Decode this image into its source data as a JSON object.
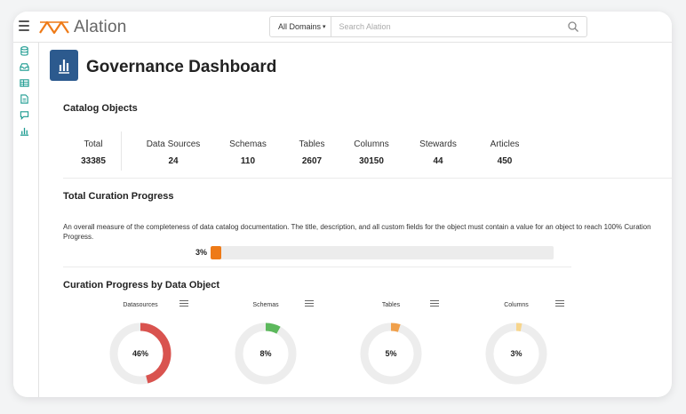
{
  "app": {
    "logo_text": "Alation"
  },
  "search": {
    "domain_label": "All Domains",
    "placeholder": "Search Alation"
  },
  "page": {
    "title": "Governance Dashboard"
  },
  "catalog": {
    "title": "Catalog Objects",
    "stats": [
      {
        "label": "Total",
        "value": "33385"
      },
      {
        "label": "Data Sources",
        "value": "24"
      },
      {
        "label": "Schemas",
        "value": "110"
      },
      {
        "label": "Tables",
        "value": "2607"
      },
      {
        "label": "Columns",
        "value": "30150"
      },
      {
        "label": "Stewards",
        "value": "44"
      },
      {
        "label": "Articles",
        "value": "450"
      }
    ]
  },
  "curation": {
    "title": "Total Curation Progress",
    "description": "An overall measure of the completeness of data catalog documentation. The title, description, and all custom fields for the object must contain a value for an object to reach 100% Curation Progress.",
    "percent_label": "3%",
    "percent": 3,
    "bar_color": "#ee7a17"
  },
  "by_object": {
    "title": "Curation Progress by Data Object",
    "charts": [
      {
        "title": "Datasources",
        "label": "46%",
        "percent": 46,
        "color": "#d9534f"
      },
      {
        "title": "Schemas",
        "label": "8%",
        "percent": 8,
        "color": "#5cb85c"
      },
      {
        "title": "Tables",
        "label": "5%",
        "percent": 5,
        "color": "#f0a04b"
      },
      {
        "title": "Columns",
        "label": "3%",
        "percent": 3,
        "color": "#f7d58c"
      }
    ]
  },
  "colors": {
    "accent": "#1a9a8f",
    "brand": "#ee7a17",
    "dashboard_icon": "#2c5a8e"
  },
  "nav_icons": [
    "database-icon",
    "inbox-icon",
    "table-icon",
    "document-icon",
    "chat-icon",
    "chart-icon"
  ]
}
